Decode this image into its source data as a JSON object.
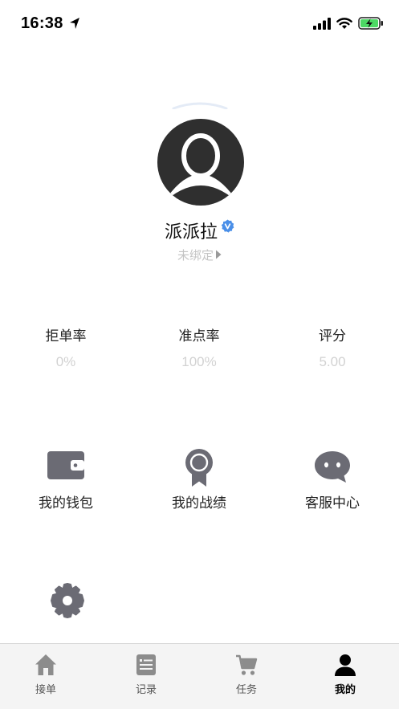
{
  "status_bar": {
    "time": "16:38"
  },
  "profile": {
    "name": "派派拉",
    "bind_status": "未绑定"
  },
  "stats": [
    {
      "label": "拒单率",
      "value": "0%"
    },
    {
      "label": "准点率",
      "value": "100%"
    },
    {
      "label": "评分",
      "value": "5.00"
    }
  ],
  "menu": [
    {
      "label": "我的钱包",
      "icon": "wallet-icon"
    },
    {
      "label": "我的战绩",
      "icon": "medal-icon"
    },
    {
      "label": "客服中心",
      "icon": "chat-bubble-icon"
    }
  ],
  "settings": {
    "icon": "gear-icon"
  },
  "tabs": [
    {
      "label": "接单",
      "icon": "home-icon",
      "active": false
    },
    {
      "label": "记录",
      "icon": "document-icon",
      "active": false
    },
    {
      "label": "任务",
      "icon": "cart-icon",
      "active": false
    },
    {
      "label": "我的",
      "icon": "person-icon",
      "active": true
    }
  ],
  "colors": {
    "icon_gray": "#6b6b74",
    "inactive_tab_icon": "#8c8c8c",
    "verified_blue": "#4a8fe8",
    "muted_text": "#c4c4c4"
  }
}
